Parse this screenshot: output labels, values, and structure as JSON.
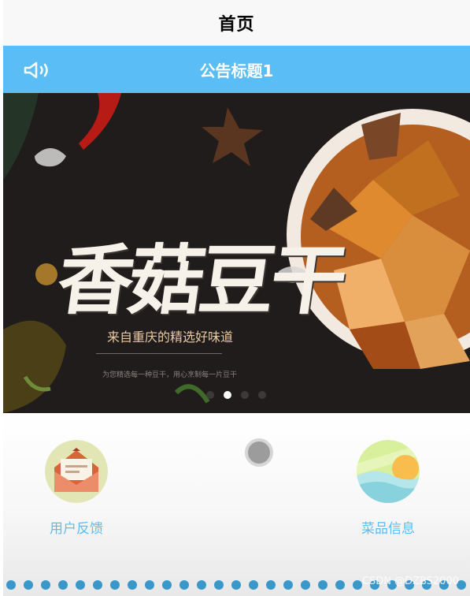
{
  "nav": {
    "title": "首页"
  },
  "notice": {
    "icon": "speaker-icon",
    "title": "公告标题1"
  },
  "banner": {
    "headline": "香菇豆干",
    "subtitle": "来自重庆的精选好味道",
    "subline": "为您精选每一种豆干，用心烹制每一片豆干",
    "slides": 4,
    "active_slide": 2
  },
  "menu": {
    "items": [
      {
        "label": "用户反馈",
        "icon": "feedback-envelope-icon"
      },
      {
        "label": "菜品信息",
        "icon": "dish-info-sunset-icon"
      }
    ]
  },
  "floating_button": {
    "icon": "assistive-touch-icon"
  },
  "watermark": "CSDN @DZBS2000",
  "colors": {
    "primary": "#5bbdf5",
    "nav_bg": "#f8f8f8",
    "banner_bg": "#1f1c1b"
  }
}
